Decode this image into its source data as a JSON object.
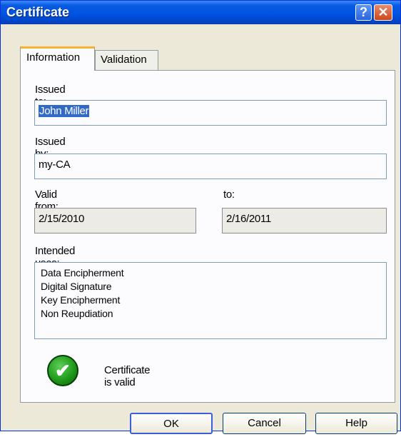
{
  "window": {
    "title": "Certificate",
    "help_glyph": "?",
    "close_glyph": "✕"
  },
  "tabs": [
    {
      "label": "Information",
      "active": true
    },
    {
      "label": "Validation",
      "active": false
    }
  ],
  "fields": {
    "issued_to_label": "Issued to:",
    "issued_to_value": "John Miller",
    "issued_by_label": "Issued by:",
    "issued_by_value": "my-CA",
    "valid_from_label": "Valid from:",
    "valid_from_value": "2/15/2010",
    "valid_to_label": "to:",
    "valid_to_value": "2/16/2011",
    "intended_uses_label": "Intended uses:",
    "intended_uses": [
      "Data Encipherment",
      "Digital Signature",
      "Key Encipherment",
      "Non Reupdiation"
    ]
  },
  "status": {
    "text": "Certificate is valid",
    "icon": "check-circle-icon",
    "check_glyph": "✔",
    "color": "#1f9a1a"
  },
  "buttons": {
    "ok": "OK",
    "cancel": "Cancel",
    "help": "Help"
  }
}
